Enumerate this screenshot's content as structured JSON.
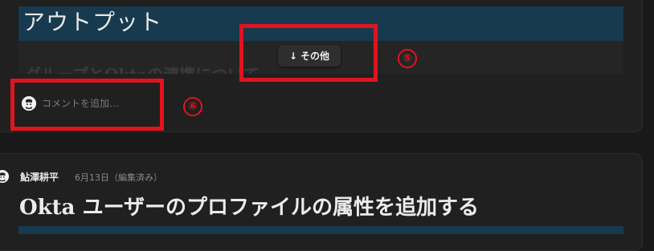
{
  "top_card": {
    "output_title": "アウトプット",
    "faded_heading": "グループとOktaの連携について",
    "more_button": {
      "label": "その他",
      "icon": "arrow-down-icon"
    },
    "comment_placeholder": "コメントを追加…"
  },
  "annotations": {
    "badge_5": "⑤",
    "badge_6": "⑥",
    "color": "#e0141e"
  },
  "post": {
    "author": "鮎澤耕平",
    "date": "6月13日（編集済み）",
    "title": "Okta ユーザーのプロファイルの属性を追加する"
  },
  "colors": {
    "background": "#191919",
    "card": "#202020",
    "banner": "#173a4e"
  }
}
